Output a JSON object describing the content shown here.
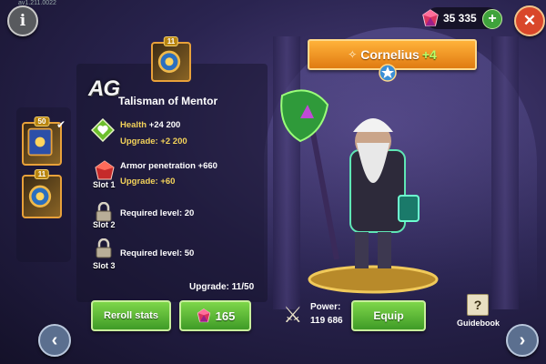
{
  "version": "av1.211.0022",
  "currency": {
    "gems": "35 335",
    "gem_color": "#d8345f"
  },
  "talisman": {
    "level": "11",
    "name": "Talisman of Mentor"
  },
  "side_items": [
    {
      "level": "50"
    },
    {
      "level": "11"
    }
  ],
  "watermark": "AG",
  "stats": {
    "health_label": "Health",
    "health_value": "+24 200",
    "health_upgrade": "Upgrade: +2 200",
    "armor_label": "Armor penetration",
    "armor_value": "+660",
    "armor_upgrade": "Upgrade: +60",
    "slot1": "Slot 1",
    "slot2": "Slot 2",
    "slot3": "Slot 3",
    "slot2_requirement": "Required level: 20",
    "slot3_requirement": "Required level: 50"
  },
  "upgrade_progress": "Upgrade: 11/50",
  "buttons": {
    "reroll": "Reroll stats",
    "cost": "165",
    "equip": "Equip",
    "guidebook": "Guidebook"
  },
  "power": {
    "label": "Power:",
    "value": "119 686"
  },
  "hero": {
    "name": "Cornelius",
    "plus": "+4"
  },
  "colors": {
    "accent_green": "#5fbf35",
    "banner_orange": "#f39a22",
    "highlight_yellow": "#f4d35a"
  },
  "icons": [
    "info-icon",
    "close-icon",
    "gem-icon",
    "plus-icon",
    "heart-icon",
    "armor-gem-icon",
    "lock-icon",
    "swords-icon",
    "guidebook-icon",
    "chevron-left-icon",
    "chevron-right-icon",
    "star-icon"
  ]
}
